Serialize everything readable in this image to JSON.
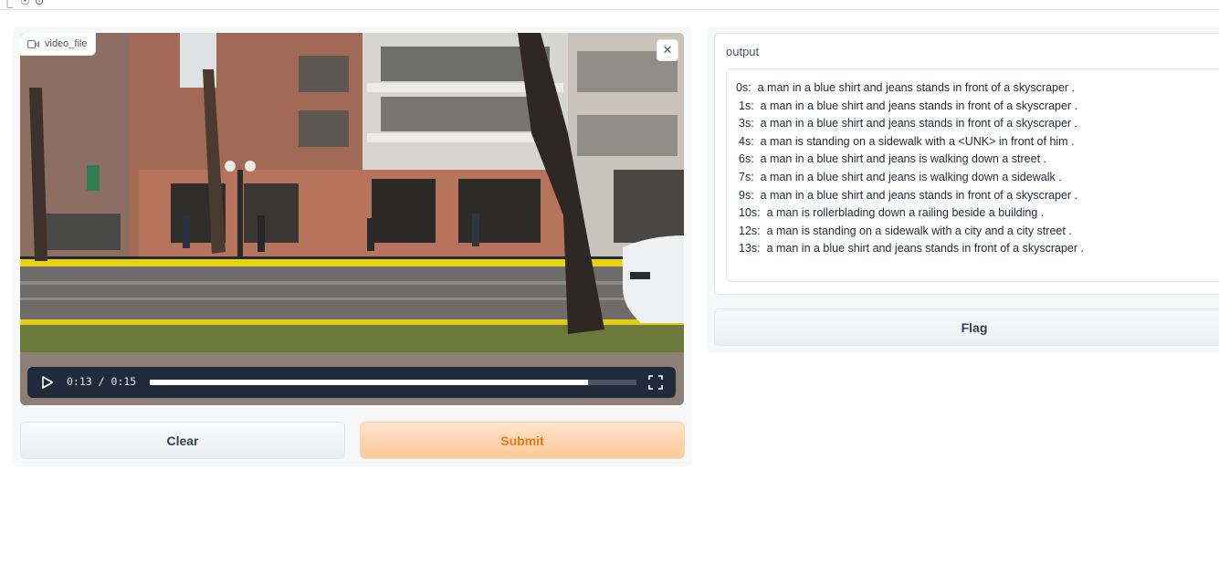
{
  "top": {
    "glyphs": [
      "⎿",
      "☉",
      "⊙"
    ]
  },
  "video": {
    "label": "video_file",
    "current_time": "0:13",
    "duration": "0:15",
    "separator": "/",
    "progress": 0.9
  },
  "buttons": {
    "clear": "Clear",
    "submit": "Submit",
    "flag": "Flag"
  },
  "output": {
    "label": "output",
    "lines": [
      "0s:  a man in a blue shirt and jeans stands in front of a skyscraper .",
      "1s:  a man in a blue shirt and jeans stands in front of a skyscraper .",
      "3s:  a man in a blue shirt and jeans stands in front of a skyscraper .",
      "4s:  a man is standing on a sidewalk with a <UNK> in front of him .",
      "6s:  a man in a blue shirt and jeans is walking down a street .",
      "7s:  a man in a blue shirt and jeans is walking down a sidewalk .",
      "9s:  a man in a blue shirt and jeans stands in front of a skyscraper .",
      "10s:  a man is rollerblading down a railing beside a building .",
      "12s:  a man is standing on a sidewalk with a city and a city street .",
      "13s:  a man in a blue shirt and jeans stands in front of a skyscraper ."
    ],
    "indents": [
      0,
      3,
      3,
      3,
      3,
      3,
      3,
      3,
      3,
      3
    ]
  },
  "colors": {
    "accent": "#ea7a12",
    "submit_bg": "#fdc99a",
    "player_bar": "#1f2a3a"
  }
}
